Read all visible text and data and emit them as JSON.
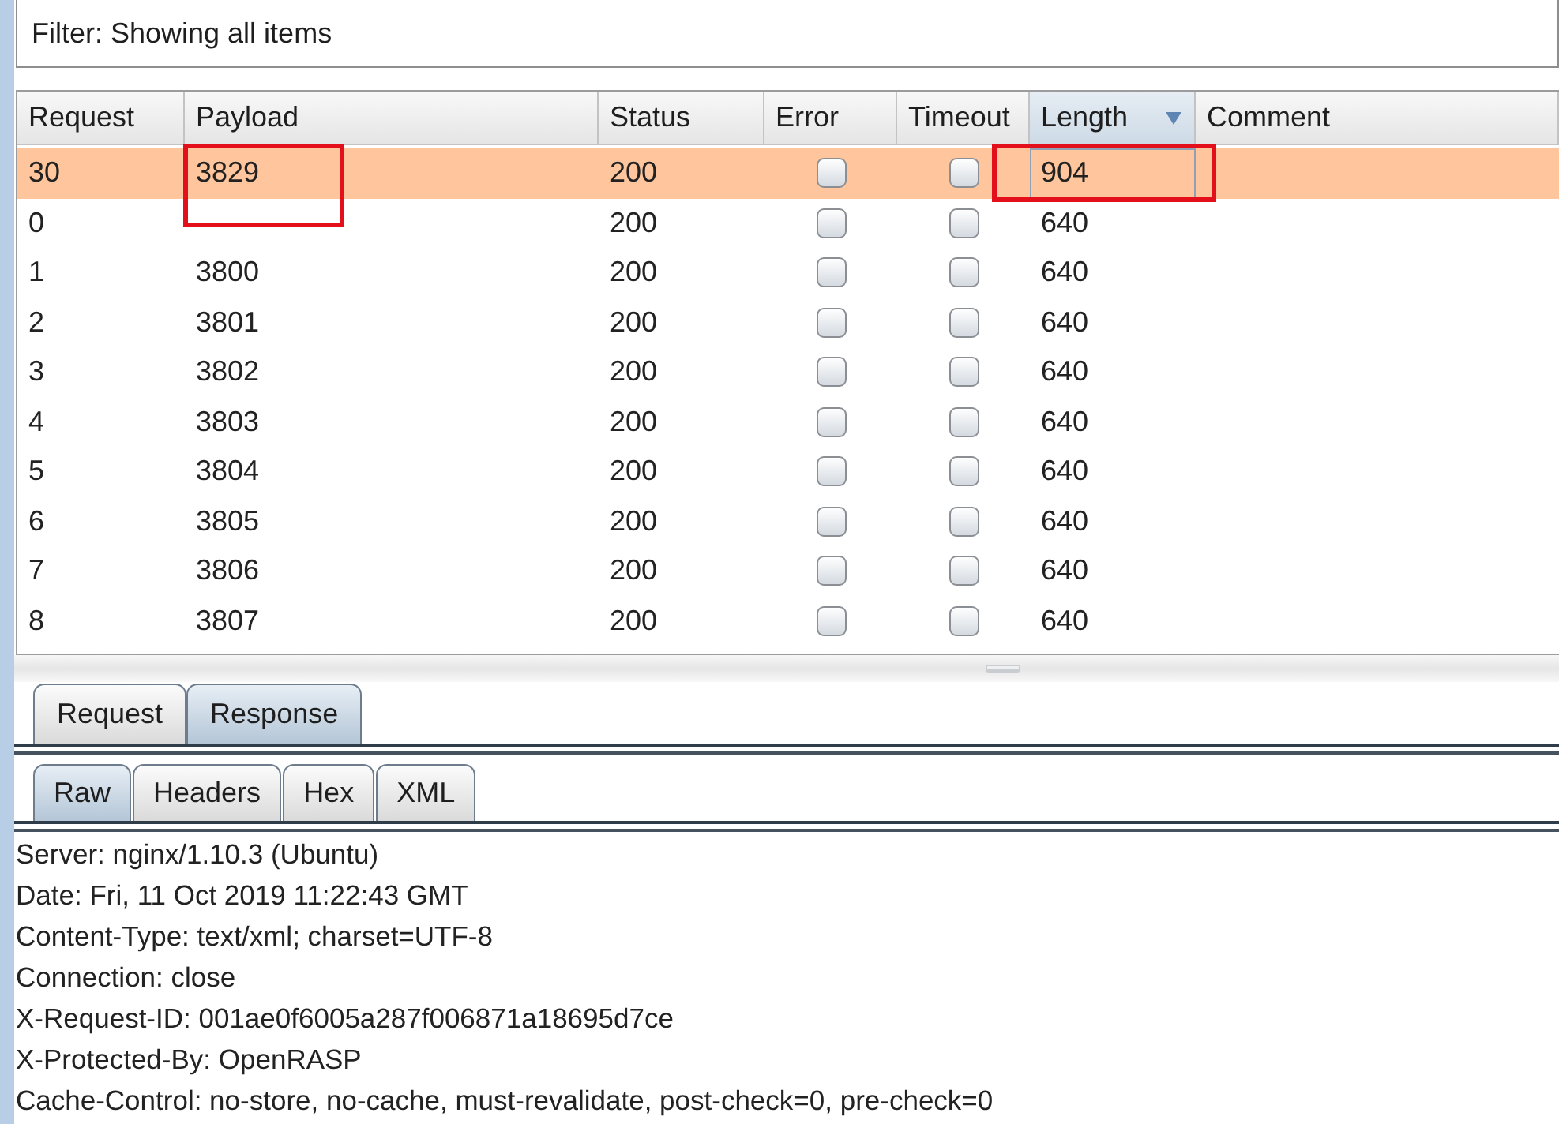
{
  "filter": {
    "text": "Filter: Showing all items"
  },
  "table": {
    "columns": [
      {
        "label": "Request",
        "sorted": false
      },
      {
        "label": "Payload",
        "sorted": false
      },
      {
        "label": "Status",
        "sorted": false
      },
      {
        "label": "Error",
        "sorted": false
      },
      {
        "label": "Timeout",
        "sorted": false
      },
      {
        "label": "Length",
        "sorted": true
      },
      {
        "label": "Comment",
        "sorted": false
      }
    ],
    "rows": [
      {
        "request": "30",
        "payload": "3829",
        "status": "200",
        "error": false,
        "timeout": false,
        "length": "904",
        "selected": true,
        "length_focused": true,
        "payload_boxed": true,
        "length_boxed": true
      },
      {
        "request": "0",
        "status": "200",
        "error": false,
        "timeout": false,
        "length": "640",
        "selected": false,
        "length_focused": false,
        "payload_boxed": false,
        "length_boxed": false
      },
      {
        "request": "1",
        "payload": "3800",
        "status": "200",
        "error": false,
        "timeout": false,
        "length": "640",
        "selected": false,
        "length_focused": false,
        "payload_boxed": false,
        "length_boxed": false
      },
      {
        "request": "2",
        "payload": "3801",
        "status": "200",
        "error": false,
        "timeout": false,
        "length": "640",
        "selected": false,
        "length_focused": false,
        "payload_boxed": false,
        "length_boxed": false
      },
      {
        "request": "3",
        "payload": "3802",
        "status": "200",
        "error": false,
        "timeout": false,
        "length": "640",
        "selected": false,
        "length_focused": false,
        "payload_boxed": false,
        "length_boxed": false
      },
      {
        "request": "4",
        "payload": "3803",
        "status": "200",
        "error": false,
        "timeout": false,
        "length": "640",
        "selected": false,
        "length_focused": false,
        "payload_boxed": false,
        "length_boxed": false
      },
      {
        "request": "5",
        "payload": "3804",
        "status": "200",
        "error": false,
        "timeout": false,
        "length": "640",
        "selected": false,
        "length_focused": false,
        "payload_boxed": false,
        "length_boxed": false
      },
      {
        "request": "6",
        "payload": "3805",
        "status": "200",
        "error": false,
        "timeout": false,
        "length": "640",
        "selected": false,
        "length_focused": false,
        "payload_boxed": false,
        "length_boxed": false
      },
      {
        "request": "7",
        "payload": "3806",
        "status": "200",
        "error": false,
        "timeout": false,
        "length": "640",
        "selected": false,
        "length_focused": false,
        "payload_boxed": false,
        "length_boxed": false
      },
      {
        "request": "8",
        "payload": "3807",
        "status": "200",
        "error": false,
        "timeout": false,
        "length": "640",
        "selected": false,
        "length_focused": false,
        "payload_boxed": false,
        "length_boxed": false
      }
    ]
  },
  "message_tabs": [
    {
      "label": "Request",
      "selected": false
    },
    {
      "label": "Response",
      "selected": true
    }
  ],
  "view_tabs": [
    {
      "label": "Raw",
      "selected": true
    },
    {
      "label": "Headers",
      "selected": false
    },
    {
      "label": "Hex",
      "selected": false
    },
    {
      "label": "XML",
      "selected": false
    }
  ],
  "response_lines": [
    "Server: nginx/1.10.3 (Ubuntu)",
    "Date: Fri, 11 Oct 2019 11:22:43 GMT",
    "Content-Type: text/xml; charset=UTF-8",
    "Connection: close",
    "X-Request-ID: 001ae0f6005a287f006871a18695d7ce",
    "X-Protected-By: OpenRASP",
    "Cache-Control: no-store, no-cache, must-revalidate, post-check=0, pre-check=0"
  ]
}
